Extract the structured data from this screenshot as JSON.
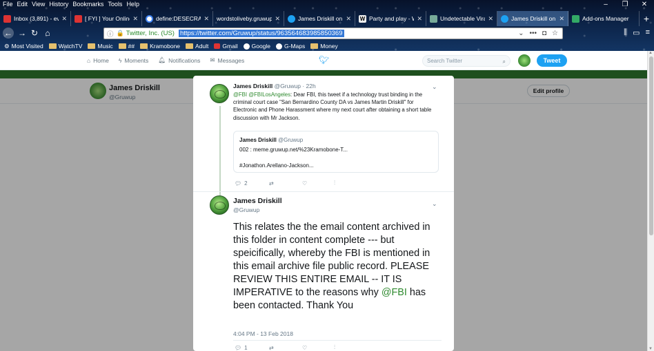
{
  "browser": {
    "menu": [
      "File",
      "Edit",
      "View",
      "History",
      "Bookmarks",
      "Tools",
      "Help"
    ],
    "tabs": [
      {
        "title": "Inbox (3,891) - every...",
        "color": "#d33"
      },
      {
        "title": "[ FYI ] Your Online Fa...",
        "color": "#d33"
      },
      {
        "title": "define:DESECRATE - ...",
        "color": "#4285f4"
      },
      {
        "title": "wordstoliveby.gruwup.ne...",
        "color": "#888"
      },
      {
        "title": "James Driskill on Twit...",
        "color": "#1da1f2"
      },
      {
        "title": "Party and play - Wiki...",
        "color": "#eee"
      },
      {
        "title": "Undetectable Viral Lo...",
        "color": "#7a9"
      },
      {
        "title": "James Driskill on Twi...",
        "color": "#1da1f2",
        "active": true
      },
      {
        "title": "Add-ons Manager",
        "color": "#3a6"
      }
    ],
    "url": {
      "org": "Twitter, Inc. (US)",
      "value": "https://twitter.com/Gruwup/status/963564683985850369"
    },
    "bookmarks": [
      "Most Visited",
      "WatchTV",
      "Music",
      "##",
      "Kramobone",
      "Adult",
      "Gmail",
      "Google",
      "G-Maps",
      "Money"
    ]
  },
  "twitter_nav": {
    "home": "Home",
    "moments": "Moments",
    "notifications": "Notifications",
    "messages": "Messages",
    "search_placeholder": "Search Twitter",
    "tweet": "Tweet"
  },
  "profile": {
    "name": "James Driskill",
    "handle": "@Gruwup",
    "edit": "Edit profile"
  },
  "tweet1": {
    "name": "James Driskill",
    "handle": "@Gruwup",
    "time": "· 22h",
    "mention1": "@FBI",
    "mention2": "@FBILosAngeles",
    "text": ": Dear FBI, this tweet if a technology trust binding in the criminal court case \"San Bernardino County DA   vs   James Martin Driskill\" for Electronic and Phone Harassment where my next court after obtaining a short table discussion with Mr Jackson.",
    "replies": "2",
    "quote": {
      "name": "James Driskill",
      "handle": "@Gruwup",
      "line1": "002 : meme.gruwup.net/%23Kramobone-T...",
      "line2": "#Jonathon.Arellano-Jackson..."
    }
  },
  "tweet2": {
    "name": "James Driskill",
    "handle": "@Gruwup",
    "text_a": "This relates the the email content archived in this folder in content complete --- but speicifically, whereby the FBI is mentioned in this email archive file public record.  PLEASE REVIEW THIS ENTIRE EMAIL -- IT IS IMPERATIVE to the reasons why ",
    "mention": "@FBI",
    "text_b": " has been contacted. Thank You",
    "date": "4:04 PM - 13 Feb 2018",
    "replies": "1"
  }
}
